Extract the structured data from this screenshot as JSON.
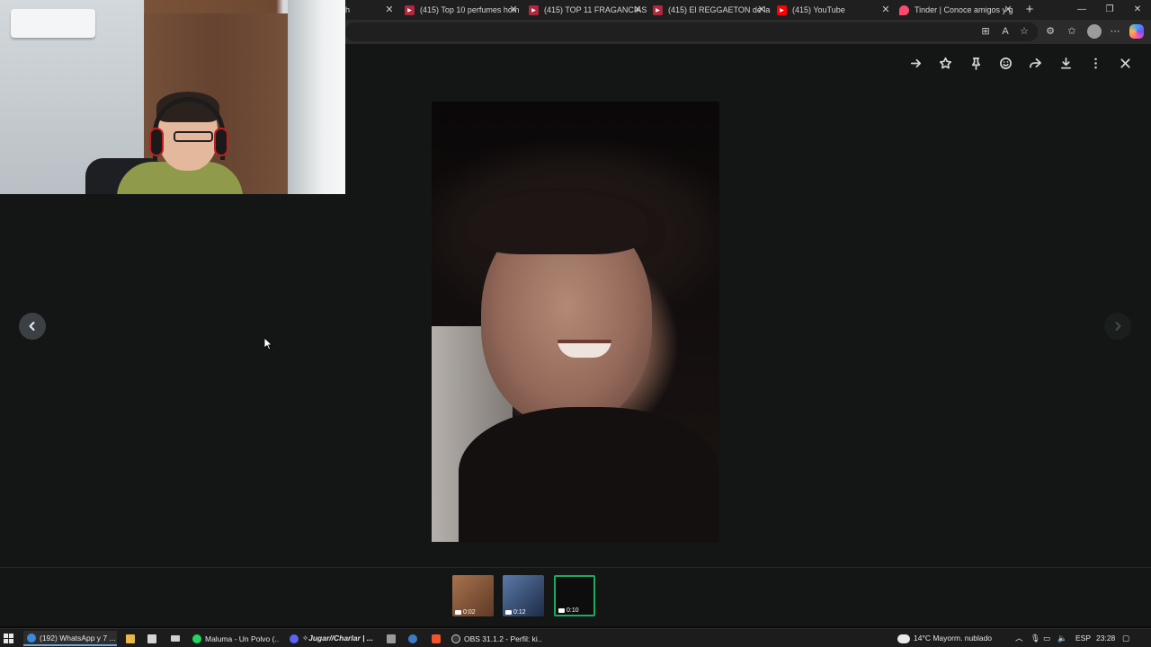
{
  "browser": {
    "tabs": [
      {
        "label": "h",
        "icon": "whatsapp-icon",
        "color": "#2b2b2b"
      },
      {
        "label": "(415) Top 10 perfumes hom",
        "icon": "youtube-icon",
        "color": "#b2273b"
      },
      {
        "label": "(415) TOP 11 FRAGANCIAS",
        "icon": "youtube-icon",
        "color": "#b2273b"
      },
      {
        "label": "(415) El REGGAETON de la",
        "icon": "youtube-icon",
        "color": "#b2273b"
      },
      {
        "label": "(415) YouTube",
        "icon": "youtube-icon",
        "color": "#ff0000"
      },
      {
        "label": "Tinder | Conoce amigos y g",
        "icon": "tinder-icon",
        "color": "#fd4a6c"
      }
    ],
    "new_tab": "+",
    "window_controls": {
      "minimize": "—",
      "restore": "❐",
      "close": "✕"
    }
  },
  "viewer": {
    "toolbar_icons": [
      "arrow-right-icon",
      "star-icon",
      "pin-icon",
      "emoji-icon",
      "forward-icon",
      "download-icon",
      "more-icon",
      "close-icon"
    ],
    "thumbnails": [
      {
        "duration": "0:02",
        "color": "#8a5a3b",
        "active": false
      },
      {
        "duration": "0:12",
        "color": "#3a4e74",
        "active": false
      },
      {
        "duration": "0:10",
        "color": "#0e0e0e",
        "active": true
      }
    ]
  },
  "taskbar": {
    "apps": [
      {
        "label": "(192) WhatsApp y 7 ...",
        "color": "#3b8ad8",
        "open": true
      },
      {
        "label": "Maluma - Un Polvo (...",
        "color": "#1ed760",
        "open": false
      },
      {
        "label": "✧Jugar//Charlar | ...",
        "color": "#5865f2",
        "open": false
      },
      {
        "label": "OBS 31.1.2 - Perfil: ki...",
        "color": "#3a3a3a",
        "open": false
      }
    ],
    "weather": "14°C  Mayorm. nublado",
    "language": "ESP",
    "time": "23:28"
  },
  "colors": {
    "accent": "#1daa61",
    "viewer_bg": "#131615"
  }
}
